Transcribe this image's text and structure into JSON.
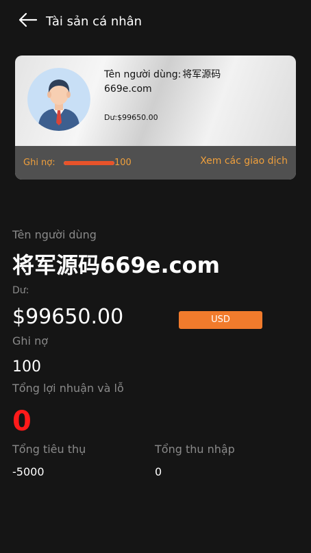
{
  "header": {
    "title": "Tài sản cá nhân",
    "back_icon": "arrow-left-icon"
  },
  "card": {
    "name_label": "Tên người dùng:",
    "name_value": "将军源码669e.com",
    "balance_text": "Dư:$99650.00",
    "avatar_icon": "user-avatar-icon",
    "debt_label": "Ghi nợ:",
    "debt_value": "100",
    "debt_level_percent": 100,
    "transactions_link": "Xem các giao dịch"
  },
  "details": {
    "username_label": "Tên người dùng",
    "username_value": "将军源码669e.com",
    "balance_label": "Dư:",
    "balance_value": "$99650.00",
    "currency_label": "USD",
    "debt_label": "Ghi nợ",
    "debt_value": "100",
    "pnl_label": "Tổng lợi nhuận và lỗ",
    "pnl_value": "0",
    "spend_label": "Tổng tiêu thụ",
    "spend_value": "-5000",
    "income_label": "Tổng thu nhập",
    "income_value": "0"
  },
  "colors": {
    "background": "#151515",
    "accent_orange": "#f17b2c",
    "link_orange": "#f0a03c",
    "loss_red": "#ff1a1a",
    "muted_label": "#8a8a8a"
  }
}
